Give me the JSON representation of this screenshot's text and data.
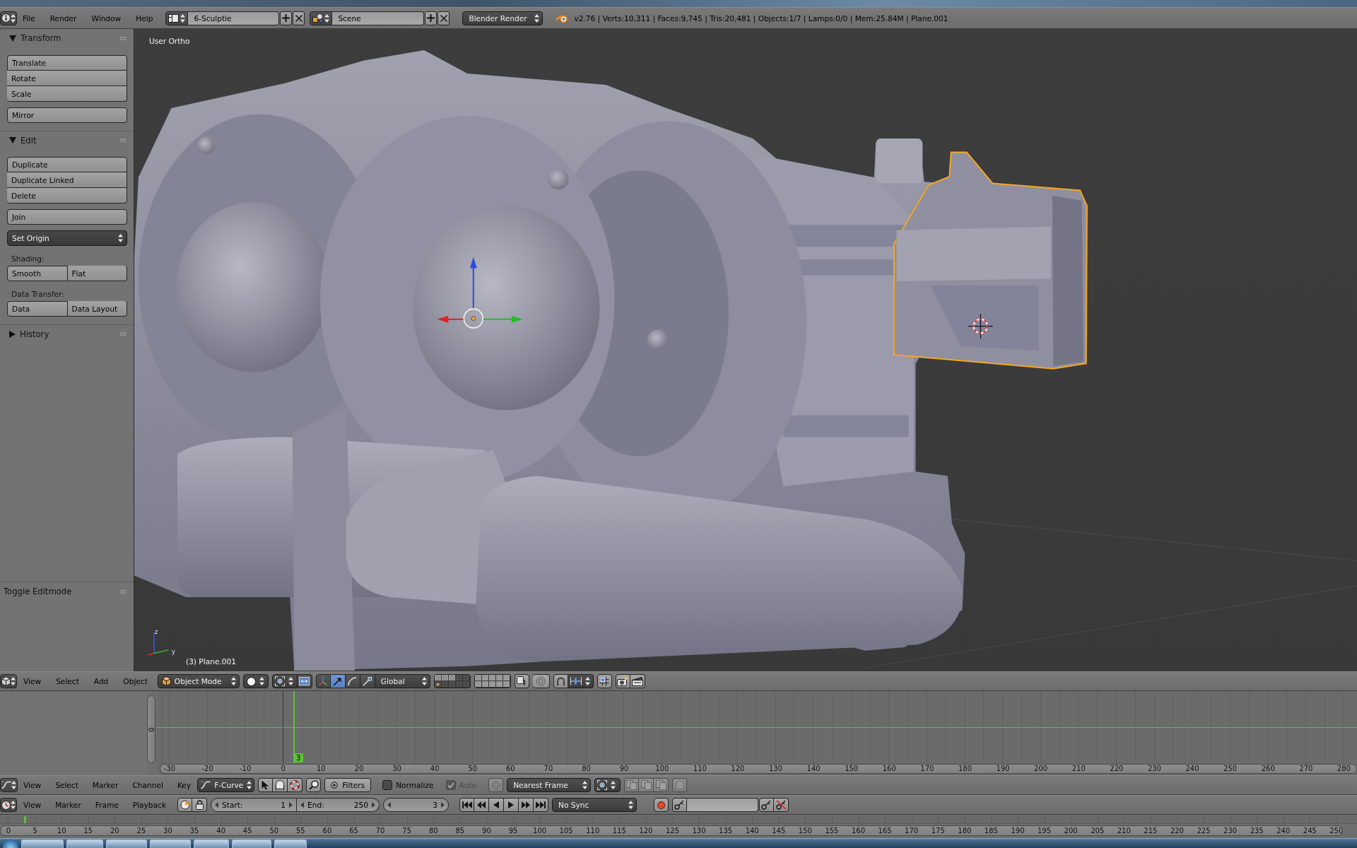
{
  "info_header": {
    "menus": [
      "File",
      "Render",
      "Window",
      "Help"
    ],
    "screen_layout": "6-Sculptie",
    "scene": "Scene",
    "render_engine": "Blender Render",
    "stats": "v2.76 | Verts:10,311 | Faces:9,745 | Tris:20,481 | Objects:1/7 | Lamps:0/0 | Mem:25.84M | Plane.001"
  },
  "tool_shelf": {
    "panels": [
      {
        "title": "Transform",
        "expanded": true,
        "rows": [
          {
            "kind": "stack",
            "buttons": [
              "Translate",
              "Rotate",
              "Scale"
            ]
          },
          {
            "kind": "stack",
            "buttons": [
              "Mirror"
            ]
          }
        ]
      },
      {
        "title": "Edit",
        "expanded": true,
        "rows": [
          {
            "kind": "stack",
            "buttons": [
              "Duplicate",
              "Duplicate Linked",
              "Delete"
            ]
          },
          {
            "kind": "stack",
            "buttons": [
              "Join"
            ]
          },
          {
            "kind": "menu",
            "label": "Set Origin"
          },
          {
            "kind": "label",
            "text": "Shading:"
          },
          {
            "kind": "split",
            "buttons": [
              "Smooth",
              "Flat"
            ]
          },
          {
            "kind": "label",
            "text": "Data Transfer:"
          },
          {
            "kind": "split",
            "buttons": [
              "Data",
              "Data Layout"
            ]
          }
        ]
      },
      {
        "title": "History",
        "expanded": false
      }
    ],
    "redo_panel": {
      "title": "Toggle Editmode"
    }
  },
  "viewport": {
    "view_name": "User Ortho",
    "objects": [
      {
        "kind": "body",
        "selected": false
      },
      {
        "kind": "attachment",
        "selected": true
      }
    ],
    "axis_labels": [
      "z",
      "y"
    ],
    "active_object": "(3) Plane.001"
  },
  "viewport_header": {
    "menus": [
      "View",
      "Select",
      "Add",
      "Object"
    ],
    "mode": "Object Mode",
    "manipulator_modes": [
      {
        "selected": true
      },
      {
        "selected": false
      },
      {
        "selected": false
      }
    ],
    "orientation": "Global",
    "layers": [
      {
        "used": true,
        "selected": false,
        "active": false
      },
      {
        "used": true,
        "selected": false,
        "active": false
      },
      {
        "used": true,
        "selected": false,
        "active": false
      },
      {
        "used": true,
        "selected": true,
        "active": false
      },
      {
        "used": true,
        "selected": true,
        "active": false
      },
      {
        "used": true,
        "selected": true,
        "active": true
      },
      {
        "used": true,
        "selected": true,
        "active": false
      },
      {
        "used": true,
        "selected": true,
        "active": false
      },
      {
        "used": true,
        "selected": true,
        "active": false
      },
      {
        "used": true,
        "selected": true,
        "active": false
      },
      {
        "used": false,
        "selected": false,
        "active": false
      },
      {
        "used": false,
        "selected": false,
        "active": false
      },
      {
        "used": false,
        "selected": false,
        "active": false
      },
      {
        "used": false,
        "selected": false,
        "active": false
      },
      {
        "used": false,
        "selected": false,
        "active": false
      },
      {
        "used": false,
        "selected": false,
        "active": false
      },
      {
        "used": false,
        "selected": false,
        "active": false
      },
      {
        "used": false,
        "selected": false,
        "active": false
      },
      {
        "used": false,
        "selected": false,
        "active": false
      },
      {
        "used": false,
        "selected": false,
        "active": false
      }
    ]
  },
  "graph_editor": {
    "value_ruler": [
      "0"
    ],
    "frame_ruler": [
      "-30",
      "-20",
      "-10",
      "0",
      "10",
      "20",
      "30",
      "40",
      "50",
      "60",
      "70",
      "80",
      "90",
      "100",
      "110",
      "120",
      "130",
      "140",
      "150",
      "160",
      "170",
      "180",
      "190",
      "200",
      "210",
      "220",
      "230",
      "240",
      "250",
      "260",
      "270",
      "280"
    ],
    "current_frame": "3"
  },
  "graph_header": {
    "menus": [
      "View",
      "Select",
      "Marker",
      "Channel",
      "Key"
    ],
    "mode": "F-Curve",
    "filters": "Filters",
    "options": [
      {
        "label": "Normalize",
        "checked": false,
        "disabled": false
      },
      {
        "label": "Auto",
        "checked": true,
        "disabled": true
      }
    ],
    "snapping": "Nearest Frame"
  },
  "timeline_header": {
    "menus": [
      "View",
      "Marker",
      "Frame",
      "Playback"
    ],
    "start": {
      "label": "Start:",
      "value": "1"
    },
    "end": {
      "label": "End:",
      "value": "250"
    },
    "current_frame": "3",
    "sync": "No Sync",
    "auto_keying": false
  },
  "timeline": {
    "frame_ruler": [
      "0",
      "5",
      "10",
      "15",
      "20",
      "25",
      "30",
      "35",
      "40",
      "45",
      "50",
      "55",
      "60",
      "65",
      "70",
      "75",
      "80",
      "85",
      "90",
      "95",
      "100",
      "105",
      "110",
      "115",
      "120",
      "125",
      "130",
      "135",
      "140",
      "145",
      "150",
      "155",
      "160",
      "165",
      "170",
      "175",
      "180",
      "185",
      "190",
      "195",
      "200",
      "205",
      "210",
      "215",
      "220",
      "225",
      "230",
      "235",
      "240",
      "245",
      "250"
    ]
  }
}
